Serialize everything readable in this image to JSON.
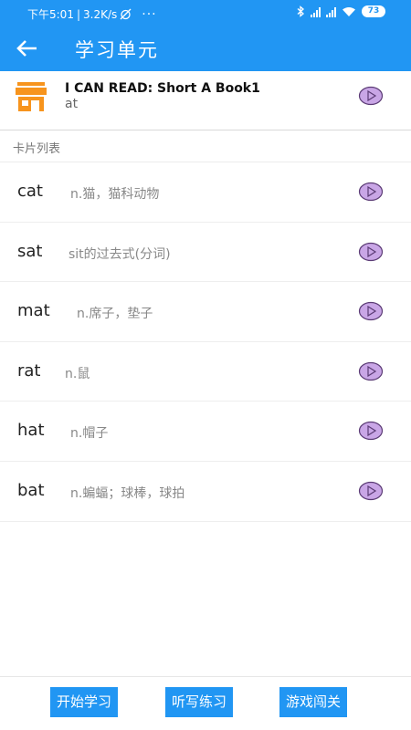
{
  "status_bar": {
    "time": "下午5:01",
    "speed": "3.2K/s",
    "more": "···",
    "battery": "73"
  },
  "app_bar": {
    "title": "学习单元"
  },
  "book": {
    "title": "I CAN READ: Short A Book1",
    "subtitle": "at"
  },
  "section": {
    "label": "卡片列表"
  },
  "cards": [
    {
      "word": "cat",
      "definition": "n.猫，猫科动物"
    },
    {
      "word": "sat",
      "definition": "sit的过去式(分词)"
    },
    {
      "word": "mat",
      "definition": "n.席子，垫子"
    },
    {
      "word": "rat",
      "definition": "n.鼠"
    },
    {
      "word": "hat",
      "definition": "n.帽子"
    },
    {
      "word": "bat",
      "definition": "n.蝙蝠；球棒，球拍"
    }
  ],
  "actions": {
    "start": "开始学习",
    "dictation": "听写练习",
    "game": "游戏闯关"
  },
  "colors": {
    "primary": "#2196f3",
    "store_icon": "#f7941d",
    "play_icon_fill": "#c9a6e6",
    "play_icon_stroke": "#5b3b75"
  }
}
